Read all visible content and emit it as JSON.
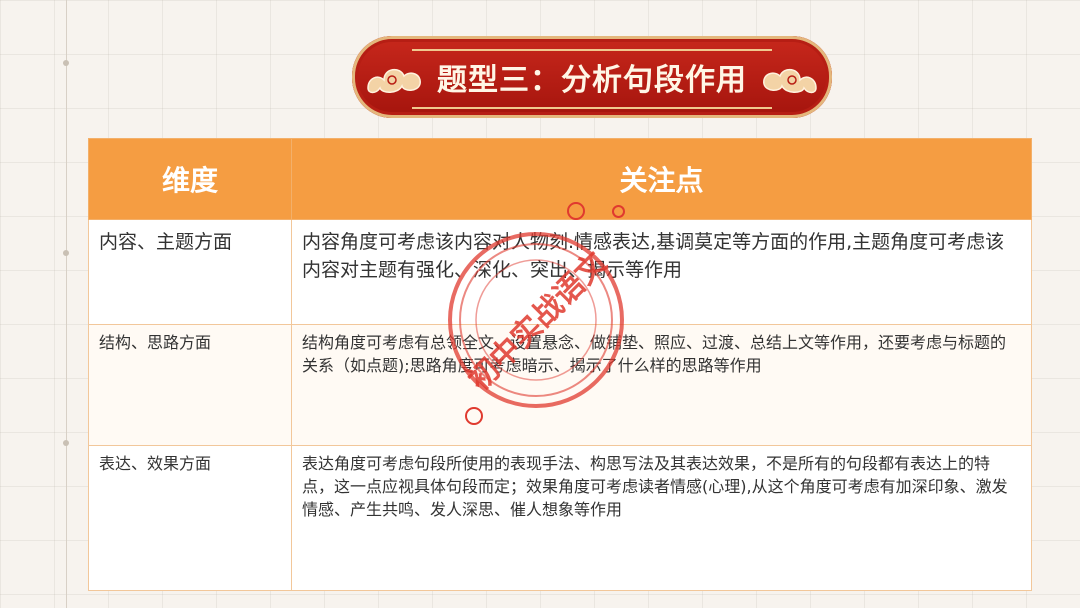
{
  "title": "题型三：分析句段作用",
  "table": {
    "headers": [
      "维度",
      "关注点"
    ],
    "rows": [
      {
        "dimension": "内容、主题方面",
        "focus": "内容角度可考虑该内容对人物刻.情感表达,基调莫定等方面的作用,主题角度可考虑该内容对主题有强化、深化、突出、揭示等作用"
      },
      {
        "dimension": "结构、思路方面",
        "focus": "结构角度可考虑有总领全文、设置悬念、做铺垫、照应、过渡、总结上文等作用，还要考虑与标题的关系（如点题);思路角度可考虑暗示、揭示了什么样的思路等作用"
      },
      {
        "dimension": "表达、效果方面",
        "focus": "表达角度可考虑句段所使用的表现手法、构思写法及其表达效果，不是所有的句段都有表达上的特点，这一点应视具体句段而定；效果角度可考虑读者情感(心理),从这个角度可考虑有加深印象、激发情感、产生共鸣、发人深思、催人想象等作用"
      }
    ]
  },
  "stamp": {
    "text": "初中实战语文",
    "color": "#e03a2f"
  },
  "colors": {
    "header": "#f59d42",
    "banner": "#b81d13",
    "accent": "#e03a2f"
  }
}
